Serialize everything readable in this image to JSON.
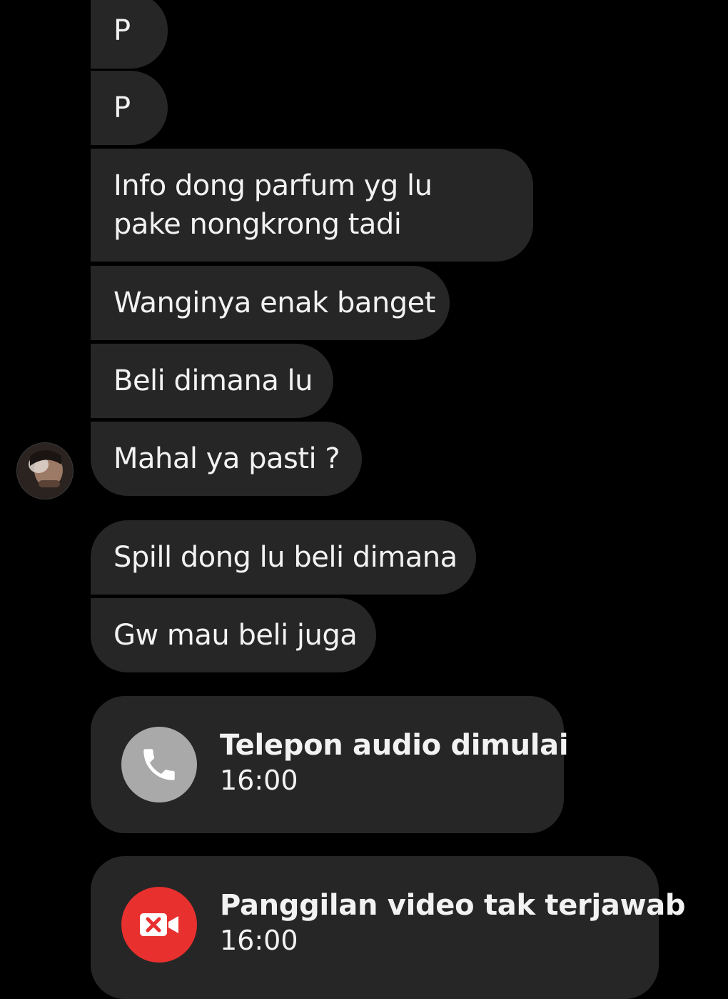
{
  "messages": [
    {
      "text": "P"
    },
    {
      "text": "P"
    },
    {
      "text": "Info dong parfum yg lu pake nongkrong tadi"
    },
    {
      "text": "Wanginya enak banget"
    },
    {
      "text": "Beli dimana lu"
    },
    {
      "text": "Mahal ya pasti ?"
    },
    {
      "text": "Spill dong lu beli dimana"
    },
    {
      "text": "Gw mau beli juga"
    }
  ],
  "calls": [
    {
      "title": "Telepon audio dimulai",
      "time": "16:00",
      "icon": "phone-icon",
      "icon_color": "#a9a9a9"
    },
    {
      "title": "Panggilan video tak terjawab",
      "time": "16:00",
      "icon": "missed-video-icon",
      "icon_color": "#e8302f"
    }
  ],
  "colors": {
    "background": "#000000",
    "bubble": "#262626",
    "text": "#f2f2f2"
  }
}
